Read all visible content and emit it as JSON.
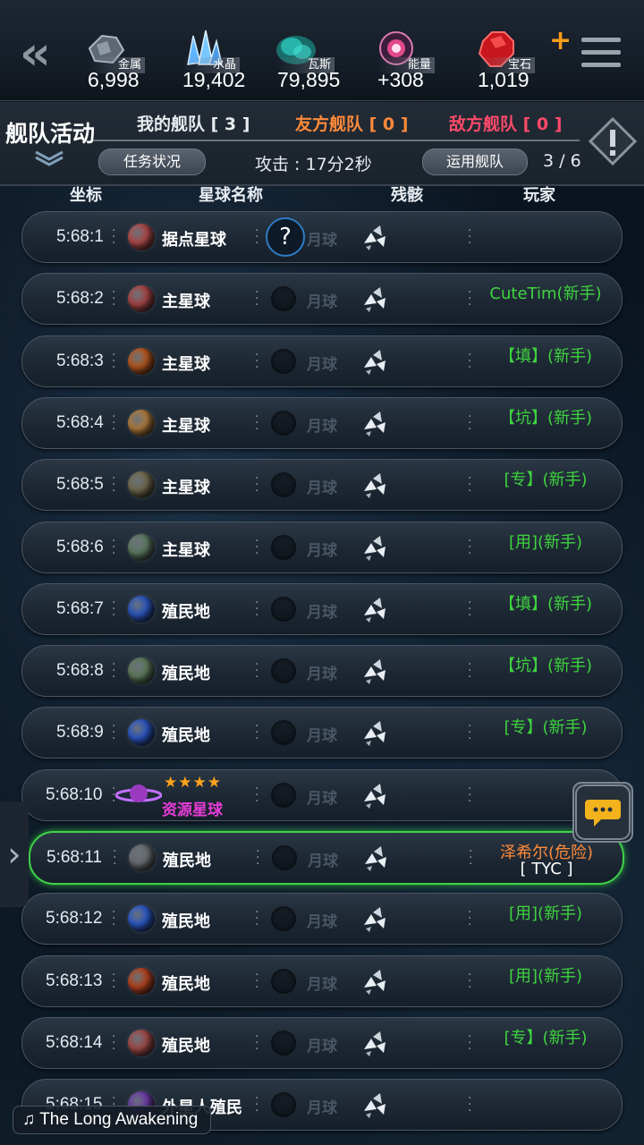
{
  "resources": [
    {
      "icon": "metal-icon",
      "label": "金属",
      "value": "6,998"
    },
    {
      "icon": "crystal-icon",
      "label": "水晶",
      "value": "19,402"
    },
    {
      "icon": "gas-icon",
      "label": "瓦斯",
      "value": "79,895"
    },
    {
      "icon": "energy-icon",
      "label": "能量",
      "value": "+308"
    },
    {
      "icon": "gem-icon",
      "label": "宝石",
      "value": "1,019"
    }
  ],
  "header": {
    "title": "舰队活动",
    "tab_my": "我的舰队 [ 3 ]",
    "tab_ally": "友方舰队 [ 0 ]",
    "tab_enemy": "敌方舰队 [ 0 ]",
    "mission_btn": "任务状况",
    "attack": "攻击 : 17分2秒",
    "deploy_btn": "运用舰队",
    "fleet_count": "3 / 6"
  },
  "columns": {
    "coord": "坐标",
    "planet": "星球名称",
    "debris": "残骸",
    "player": "玩家"
  },
  "moon_label": "月球",
  "rows": [
    {
      "coord": "5:68:1",
      "planet": "据点星球",
      "player": "",
      "color": "#b04a4a"
    },
    {
      "coord": "5:68:2",
      "planet": "主星球",
      "player": "CuteTim(新手)",
      "color": "#a84545"
    },
    {
      "coord": "5:68:3",
      "planet": "主星球",
      "player": "【填】(新手)",
      "color": "#b5561c"
    },
    {
      "coord": "5:68:4",
      "planet": "主星球",
      "player": "【坑】(新手)",
      "color": "#b07a3c"
    },
    {
      "coord": "5:68:5",
      "planet": "主星球",
      "player": "[专】(新手)",
      "color": "#6f6a4e"
    },
    {
      "coord": "5:68:6",
      "planet": "主星球",
      "player": "[用](新手)",
      "color": "#5d7a62"
    },
    {
      "coord": "5:68:7",
      "planet": "殖民地",
      "player": "【填】(新手)",
      "color": "#2b56c0"
    },
    {
      "coord": "5:68:8",
      "planet": "殖民地",
      "player": "【坑】(新手)",
      "color": "#5e7a5c"
    },
    {
      "coord": "5:68:9",
      "planet": "殖民地",
      "player": "[专】(新手)",
      "color": "#2a55c2"
    },
    {
      "coord": "5:68:10",
      "planet": "资源星球",
      "player": "",
      "color": "#9a3bbf"
    },
    {
      "coord": "5:68:11",
      "planet": "殖民地",
      "player": "泽希尔(危险)",
      "player2": "[ TYC ]",
      "color": "#6a6c70"
    },
    {
      "coord": "5:68:12",
      "planet": "殖民地",
      "player": "[用](新手)",
      "color": "#2a58c6"
    },
    {
      "coord": "5:68:13",
      "planet": "殖民地",
      "player": "[用](新手)",
      "color": "#b3421e"
    },
    {
      "coord": "5:68:14",
      "planet": "殖民地",
      "player": "[专】(新手)",
      "color": "#a04a48"
    },
    {
      "coord": "5:68:15",
      "planet": "外星人殖民",
      "player": "",
      "color": "#6b3aa8"
    }
  ],
  "music": "The Long Awakening"
}
